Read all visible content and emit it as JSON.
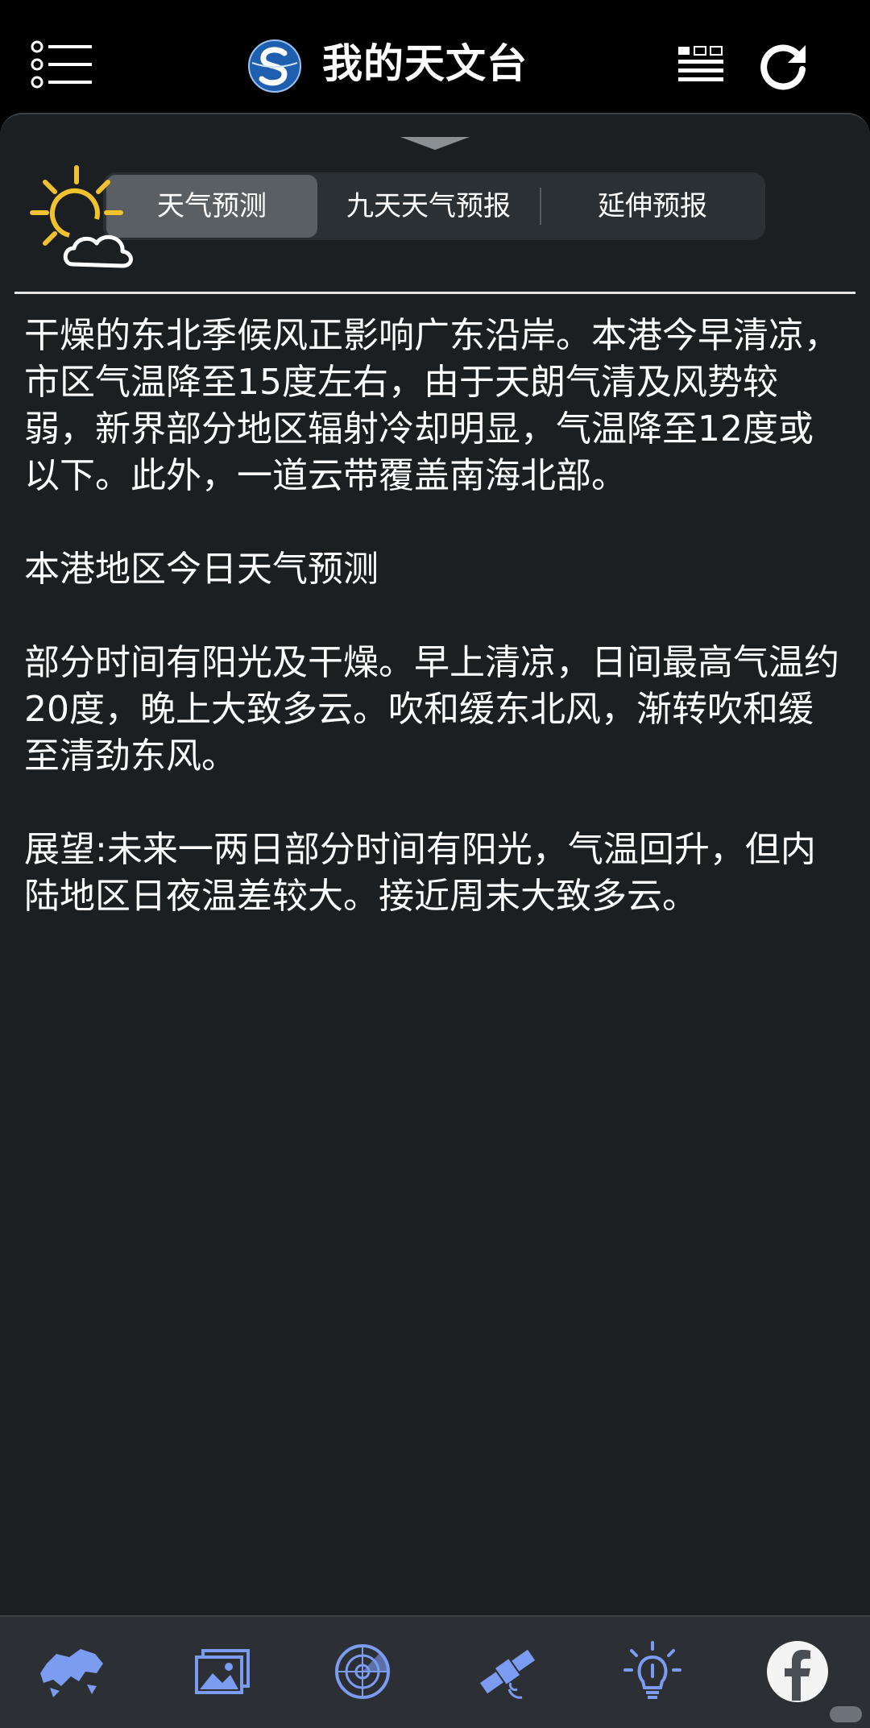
{
  "header": {
    "title": "我的天文台",
    "menu_icon": "menu-list-icon",
    "logo_icon": "observatory-logo-icon",
    "layout_icon": "layout-toggle-icon",
    "refresh_icon": "refresh-icon"
  },
  "tabs": [
    {
      "label": "天气预测",
      "selected": true
    },
    {
      "label": "九天天气预报",
      "selected": false
    },
    {
      "label": "延伸预报",
      "selected": false
    }
  ],
  "forecast": {
    "icon": "sunny-periods-cloud-icon",
    "paragraphs": [
      "干燥的东北季候风正影响广东沿岸。本港今早清凉，市区气温降至15度左右，由于天朗气清及风势较弱，新界部分地区辐射冷却明显，气温降至12度或以下。此外，一道云带覆盖南海北部。",
      "本港地区今日天气预测",
      "部分时间有阳光及干燥。早上清凉，日间最高气温约20度，晚上大致多云。吹和缓东北风，渐转吹和缓至清劲东风。",
      "展望:未来一两日部分时间有阳光，气温回升，但内陆地区日夜温差较大。接近周末大致多云。"
    ]
  },
  "bottom_nav": [
    {
      "icon": "hong-kong-map-icon"
    },
    {
      "icon": "photo-gallery-icon"
    },
    {
      "icon": "radar-icon"
    },
    {
      "icon": "satellite-icon"
    },
    {
      "icon": "weather-tips-bulb-icon"
    },
    {
      "icon": "facebook-icon"
    }
  ],
  "colors": {
    "background": "#000000",
    "panel": "#1b1f22",
    "tab_selected": "#5a5f63",
    "nav_icon": "#7c9cf2",
    "sun": "#f2c22e"
  }
}
